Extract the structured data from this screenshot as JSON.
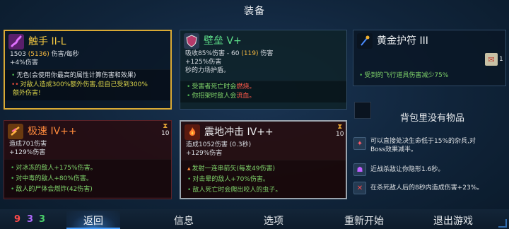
{
  "title": "装备",
  "weapons": [
    {
      "name": "触手 II-L",
      "icon": "tentacle-icon",
      "stat_line_prefix": "1503",
      "stat_line_paren": "(5136)",
      "stat_line_suffix": "伤害/每秒",
      "stat_bonus": "+4%伤害",
      "effects": [
        {
          "text": "无色(会使用你最高的属性计算伤害和效果)",
          "color": "white"
        },
        {
          "text": "对敌人造成300%额外伤害,但自己受到300%",
          "color": "yellow"
        },
        {
          "text": "额外伤害!",
          "color": "yellow"
        }
      ]
    },
    {
      "name": "极速 IV++",
      "icon": "speed-icon",
      "stat_line": "造成701伤害",
      "stat_bonus": "+129%伤害",
      "cooldown": "10",
      "effects": [
        {
          "text": "对冰冻的敌人+175%伤害。",
          "color": "green"
        },
        {
          "text": "对中毒的敌人+80%伤害。",
          "color": "green"
        },
        {
          "text": "敌人的尸体会燃炸(42伤害)",
          "color": "green"
        }
      ]
    }
  ],
  "skills": [
    {
      "name": "壁垒 V+",
      "icon": "shield-icon",
      "stat_prefix": "吸收85%伤害 - 60",
      "stat_paren": "(119)",
      "stat_suffix": "伤害",
      "stat_bonus": "+125%伤害",
      "stat_extra": "秒的力场护盾。",
      "effects": [
        {
          "text": "受害者死亡时会",
          "hl": "燃烧。",
          "color": "green"
        },
        {
          "text": "你招架时敌人会",
          "hl": "流血。",
          "color": "green"
        }
      ]
    },
    {
      "name": "震地冲击 IV++",
      "icon": "ground-slam-icon",
      "stat_line": "造成1052伤害 (0.3秒)",
      "stat_bonus": "+129%伤害",
      "cooldown": "10",
      "effects": [
        {
          "text": "发射一连串箭矢(每发49伤害)",
          "color": "green"
        },
        {
          "text": "对击晕的敌人+70%伤害。",
          "color": "green"
        },
        {
          "text": "敌人死亡时会爬出咬人的虫子。",
          "color": "green"
        }
      ]
    }
  ],
  "amulet": {
    "name": "黄金护符 III",
    "icon": "amulet-icon",
    "effect": "受到的飞行道具伤害减少75%",
    "charm_count": "1"
  },
  "inventory": {
    "empty_label": "背包里没有物品"
  },
  "buffs": [
    {
      "icon": "execute-icon",
      "text_1": "可以直接处决生命低于15%的杂兵,对",
      "text_2": "Boss效果减半。"
    },
    {
      "icon": "stealth-icon",
      "text_1": "近战杀敌让你隐形1.6秒。",
      "text_2": ""
    },
    {
      "icon": "damage-buff-icon",
      "text_1": "在杀死敌人后的8秒内造成伤害+23%。",
      "text_2": ""
    }
  ],
  "scrolls": {
    "red": "9",
    "purple": "3",
    "green": "3"
  },
  "menu": {
    "back": "返回",
    "info": "信息",
    "options": "选项",
    "restart": "重新开始",
    "quit": "退出游戏"
  },
  "colors": {
    "gold_border": "#d9a934",
    "silver_border": "#9aa4ae",
    "accent_blue": "#4aa0ff"
  }
}
